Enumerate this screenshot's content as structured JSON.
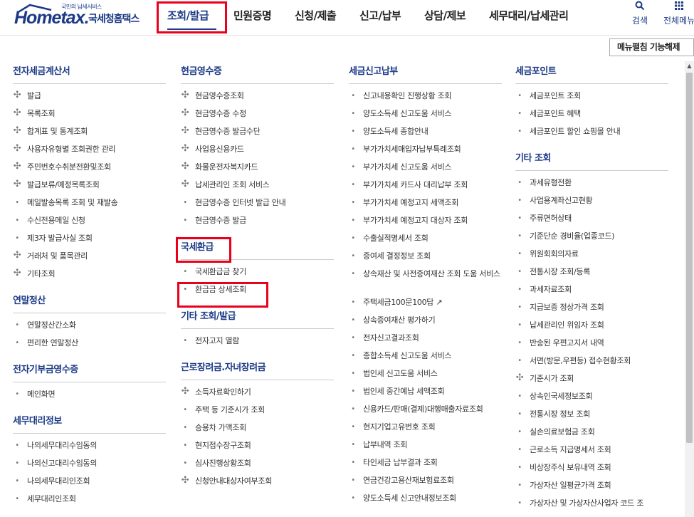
{
  "header": {
    "logo_small": "국민의 납세서비스",
    "logo_main": "Hometax.",
    "logo_kr": "국세청홈택스",
    "nav": [
      "조회/발급",
      "민원증명",
      "신청/제출",
      "신고/납부",
      "상담/제보",
      "세무대리/납세관리"
    ],
    "search_label": "검색",
    "allmenu_label": "전체메뉴"
  },
  "fold_button": "메뉴펼침 기능해제",
  "columns": [
    {
      "sections": [
        {
          "title": "전자세금계산서",
          "items": [
            {
              "t": "발급",
              "m": "plus"
            },
            {
              "t": "목록조회",
              "m": "plus"
            },
            {
              "t": "합계표 및 통계조회",
              "m": "plus"
            },
            {
              "t": "사용자유형별 조회권한 관리",
              "m": "plus"
            },
            {
              "t": "주민번호수취분전환및조회",
              "m": "plus"
            },
            {
              "t": "발급보류/예정목록조회",
              "m": "plus"
            },
            {
              "t": "메일발송목록 조회 및 재발송",
              "m": "dot"
            },
            {
              "t": "수신전용메일 신청",
              "m": "dot"
            },
            {
              "t": "제3자 발급사실 조회",
              "m": "dot"
            },
            {
              "t": "거래처 및 품목관리",
              "m": "plus"
            },
            {
              "t": "기타조회",
              "m": "plus"
            }
          ]
        },
        {
          "title": "연말정산",
          "items": [
            {
              "t": "연말정산간소화",
              "m": "dot"
            },
            {
              "t": "편리한 연말정산",
              "m": "dot"
            }
          ]
        },
        {
          "title": "전자기부금영수증",
          "items": [
            {
              "t": "메인화면",
              "m": "dot"
            }
          ]
        },
        {
          "title": "세무대리정보",
          "items": [
            {
              "t": "나의세무대리수임동의",
              "m": "dot"
            },
            {
              "t": "나의신고대리수임동의",
              "m": "dot"
            },
            {
              "t": "나의세무대리인조회",
              "m": "dot"
            },
            {
              "t": "세무대리인조회",
              "m": "dot"
            }
          ]
        }
      ]
    },
    {
      "sections": [
        {
          "title": "현금영수증",
          "items": [
            {
              "t": "현금영수증조회",
              "m": "plus"
            },
            {
              "t": "현금영수증 수정",
              "m": "plus"
            },
            {
              "t": "현금영수증 발급수단",
              "m": "plus"
            },
            {
              "t": "사업용신용카드",
              "m": "plus"
            },
            {
              "t": "화물운전자복지카드",
              "m": "plus"
            },
            {
              "t": "납세관리인 조회 서비스",
              "m": "plus"
            },
            {
              "t": "현금영수증 인터넷 발급 안내",
              "m": "dot"
            },
            {
              "t": "현금영수증 발급",
              "m": "dot"
            }
          ]
        },
        {
          "title": "국세환급",
          "items": [
            {
              "t": "국세환급금 찾기",
              "m": "dot"
            },
            {
              "t": "환급금 상세조회",
              "m": "dot"
            }
          ]
        },
        {
          "title": "기타 조회/발급",
          "items": [
            {
              "t": "전자고지 열람",
              "m": "dot"
            }
          ]
        },
        {
          "title": "근로장려금.자녀장려금",
          "items": [
            {
              "t": "소득자료확인하기",
              "m": "plus"
            },
            {
              "t": "주택 등 기준시가 조회",
              "m": "dot"
            },
            {
              "t": "승용차 가액조회",
              "m": "dot"
            },
            {
              "t": "현지접수장구조회",
              "m": "dot"
            },
            {
              "t": "심사진행상황조회",
              "m": "dot"
            },
            {
              "t": "신청안내대상자여부조회",
              "m": "plus"
            }
          ]
        }
      ]
    },
    {
      "sections": [
        {
          "title": "세금신고납부",
          "items": [
            {
              "t": "신고내용확인 진행상황 조회",
              "m": "dot"
            },
            {
              "t": "양도소득세 신고도움 서비스",
              "m": "dot"
            },
            {
              "t": "양도소득세 종합안내",
              "m": "dot"
            },
            {
              "t": "부가가치세매입자납부특례조회",
              "m": "dot"
            },
            {
              "t": "부가가치세 신고도움 서비스",
              "m": "dot"
            },
            {
              "t": "부가가치세 카드사 대리납부 조회",
              "m": "dot"
            },
            {
              "t": "부가가치세 예정고지 세액조회",
              "m": "dot"
            },
            {
              "t": "부가가치세 예정고지 대상자 조회",
              "m": "dot"
            },
            {
              "t": "수출실적명세서 조회",
              "m": "dot"
            },
            {
              "t": "증여세 결정정보 조회",
              "m": "dot"
            },
            {
              "t": "상속재산 및 사전증여재산 조회 도움 서비스",
              "m": "dot",
              "tall": true
            },
            {
              "t": "주택세금100문100답",
              "m": "dot",
              "ext": true
            },
            {
              "t": "상속증여재산 평가하기",
              "m": "dot"
            },
            {
              "t": "전자신고결과조회",
              "m": "dot"
            },
            {
              "t": "종합소득세 신고도움 서비스",
              "m": "dot"
            },
            {
              "t": "법인세 신고도움 서비스",
              "m": "dot"
            },
            {
              "t": "법인세 중간예납 세액조회",
              "m": "dot"
            },
            {
              "t": "신용카드/판매(결제)대행매출자료조회",
              "m": "dot"
            },
            {
              "t": "현지기업고유번호 조회",
              "m": "dot"
            },
            {
              "t": "납부내역 조회",
              "m": "dot"
            },
            {
              "t": "타인세금 납부결과 조회",
              "m": "dot"
            },
            {
              "t": "연금건강고용산재보험료조회",
              "m": "dot"
            },
            {
              "t": "양도소득세 신고안내정보조회",
              "m": "dot"
            }
          ]
        }
      ]
    },
    {
      "sections": [
        {
          "title": "세금포인트",
          "items": [
            {
              "t": "세금포인트 조회",
              "m": "dot"
            },
            {
              "t": "세금포인트 혜택",
              "m": "dot"
            },
            {
              "t": "세금포인트 할인 쇼핑몰 안내",
              "m": "dot"
            }
          ]
        },
        {
          "title": "기타 조회",
          "items": [
            {
              "t": "과세유형전환",
              "m": "dot"
            },
            {
              "t": "사업용계좌신고현황",
              "m": "dot"
            },
            {
              "t": "주류면허상태",
              "m": "dot"
            },
            {
              "t": "기준단순 경비율(업종코드)",
              "m": "dot"
            },
            {
              "t": "위원회회의자료",
              "m": "dot"
            },
            {
              "t": "전통시장 조회/등록",
              "m": "dot"
            },
            {
              "t": "과세자료조회",
              "m": "dot"
            },
            {
              "t": "지급보증 정상가격 조회",
              "m": "dot"
            },
            {
              "t": "납세관리인 위임자 조회",
              "m": "dot"
            },
            {
              "t": "반송된 우편고지서 내역",
              "m": "dot"
            },
            {
              "t": "서면(방문,우편등) 접수현황조회",
              "m": "dot"
            },
            {
              "t": "기준시가 조회",
              "m": "plus"
            },
            {
              "t": "상속인국세정보조회",
              "m": "dot"
            },
            {
              "t": "전통시장 정보 조회",
              "m": "dot"
            },
            {
              "t": "실손의료보험금 조회",
              "m": "dot"
            },
            {
              "t": "근로소득 지급명세서 조회",
              "m": "dot"
            },
            {
              "t": "비상장주식 보유내역 조회",
              "m": "dot"
            },
            {
              "t": "가상자산 일평균가격 조회",
              "m": "dot"
            },
            {
              "t": "가상자산 및 가상자산사업자 코드 조",
              "m": "dot"
            }
          ]
        }
      ]
    }
  ],
  "colors": {
    "brand": "#1c3a86",
    "highlight": "#e8001c",
    "marker": "#777777"
  }
}
